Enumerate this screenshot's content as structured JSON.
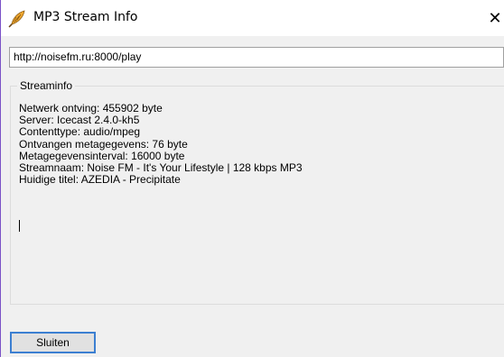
{
  "window": {
    "title": "MP3 Stream Info",
    "icon": "mp3-feather-icon",
    "close_glyph": "✕"
  },
  "url_field": {
    "value": "http://noisefm.ru:8000/play"
  },
  "streaminfo": {
    "legend": "Streaminfo",
    "lines": [
      "Netwerk ontving: 455902 byte",
      "Server: Icecast 2.4.0-kh5",
      "Contenttype: audio/mpeg",
      "Ontvangen metagegevens: 76 byte",
      "Metagegevensinterval: 16000 byte",
      "Streamnaam: Noise FM - It's Your Lifestyle | 128 kbps MP3",
      "Huidige titel: AZEDIA - Precipitate"
    ]
  },
  "buttons": {
    "close_label": "Sluiten"
  },
  "colors": {
    "window_frame": "#7a52c7",
    "button_focus": "#3c7fd1",
    "background": "#f0f0f0"
  }
}
